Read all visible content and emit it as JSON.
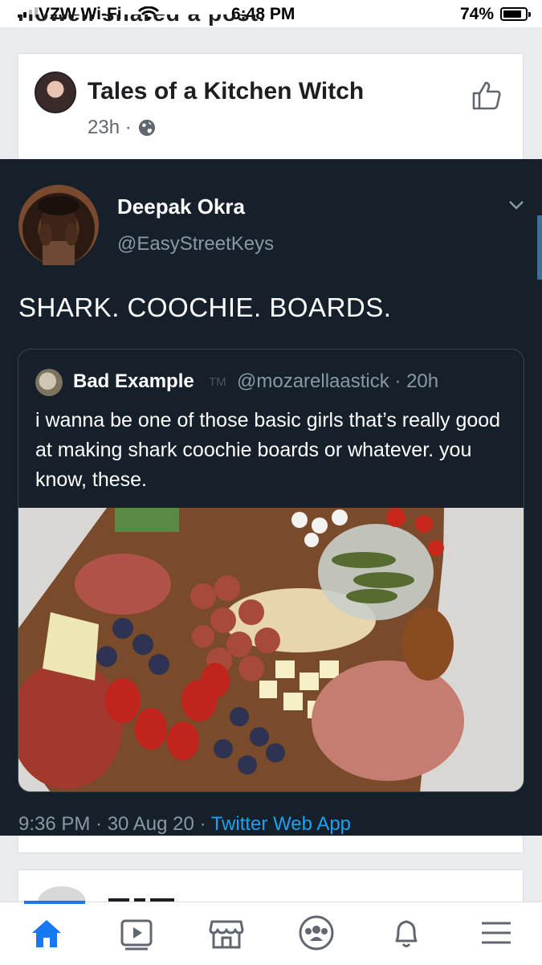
{
  "status_bar": {
    "carrier": "VZW Wi-Fi",
    "time": "6:48 PM",
    "battery": "74%",
    "battery_level": 0.74
  },
  "clipped_header_text": "Howell shared a post.",
  "post": {
    "page_name": "Tales of a Kitchen Witch",
    "time_ago": "23h ·",
    "privacy_icon": "globe-icon",
    "like_icon": "thumbs-up-icon"
  },
  "tweet": {
    "author_name": "Deepak Okra",
    "author_handle": "@EasyStreetKeys",
    "text": "SHARK. COOCHIE. BOARDS.",
    "quoted": {
      "author_name": "Bad Example",
      "tm": "TM",
      "handle_time": "@mozarellaastick · 20h",
      "text": "i wanna be one of those basic girls that’s really good at making shark coochie boards or whatever. you know, these."
    },
    "timestamp": "9:36 PM · 30 Aug 20 · ",
    "source": "Twitter Web App"
  },
  "colors": {
    "tweet_bg": "#15202b",
    "tweet_muted": "#8899a6",
    "link_blue": "#1da1f2",
    "fb_blue": "#1877f2"
  },
  "bottom_nav": {
    "items": [
      "home-icon",
      "watch-icon",
      "marketplace-icon",
      "groups-icon",
      "notifications-icon",
      "menu-icon"
    ],
    "active": "home-icon"
  }
}
